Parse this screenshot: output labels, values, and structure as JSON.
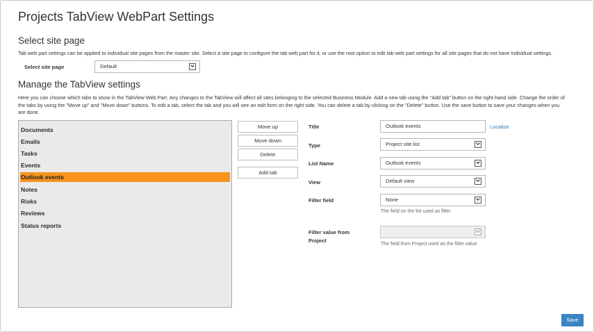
{
  "page": {
    "title": "Projects TabView WebPart Settings"
  },
  "site_page": {
    "heading": "Select site page",
    "description": "Tab web part settings can be applied to individual site pages from the master site. Select a site page to configure the tab web part for it, or use the root option to edit tab web part settings for all site pages that do not have individual settings.",
    "select_label": "Select site page",
    "select_value": "Default"
  },
  "manage": {
    "heading": "Manage the TabView settings",
    "description_lines": [
      "Here you can choose which tabs to show in the TabView Web Part. Any changes to the TabView will affect all sites belonging to the selected Business Module. Add a new tab using the \"Add tab\" button on the right-hand side. Change the order of",
      "the tabs by using the \"Move up\" and \"Move down\" buttons. To edit a tab, select the tab and you will see an edit form on the right side. You can delete a tab by clicking on the \"Delete\" button. Use the save button to save your changes when you",
      "are done."
    ]
  },
  "tabs": [
    {
      "label": "Documents",
      "selected": false
    },
    {
      "label": "Emails",
      "selected": false
    },
    {
      "label": "Tasks",
      "selected": false
    },
    {
      "label": "Events",
      "selected": false
    },
    {
      "label": "Outlook events",
      "selected": true
    },
    {
      "label": "Notes",
      "selected": false
    },
    {
      "label": "Risks",
      "selected": false
    },
    {
      "label": "Reviews",
      "selected": false
    },
    {
      "label": "Status reports",
      "selected": false
    }
  ],
  "buttons": {
    "move_up": "Move up",
    "move_down": "Move down",
    "delete": "Delete",
    "add_tab": "Add tab",
    "save": "Save"
  },
  "form": {
    "title_label": "Title",
    "title_value": "Outlook events",
    "localize_link": "Localize",
    "type_label": "Type",
    "type_value": "Project site list",
    "list_name_label": "List Name",
    "list_name_value": "Outlook events",
    "view_label": "View",
    "view_value": "Default view",
    "filter_field_label": "Filter field",
    "filter_field_value": "None",
    "filter_field_hint": "The field on the list used as filter.",
    "filter_value_label_line1": "Filter value from",
    "filter_value_label_line2": "Project",
    "filter_value_value": "",
    "filter_value_hint": "The field from Project used as the filter value."
  },
  "colors": {
    "selected_tab": "#f7931e",
    "save_button": "#3a84c4",
    "link": "#2a7ab8"
  },
  "icons": [
    "chevron-down-icon"
  ]
}
